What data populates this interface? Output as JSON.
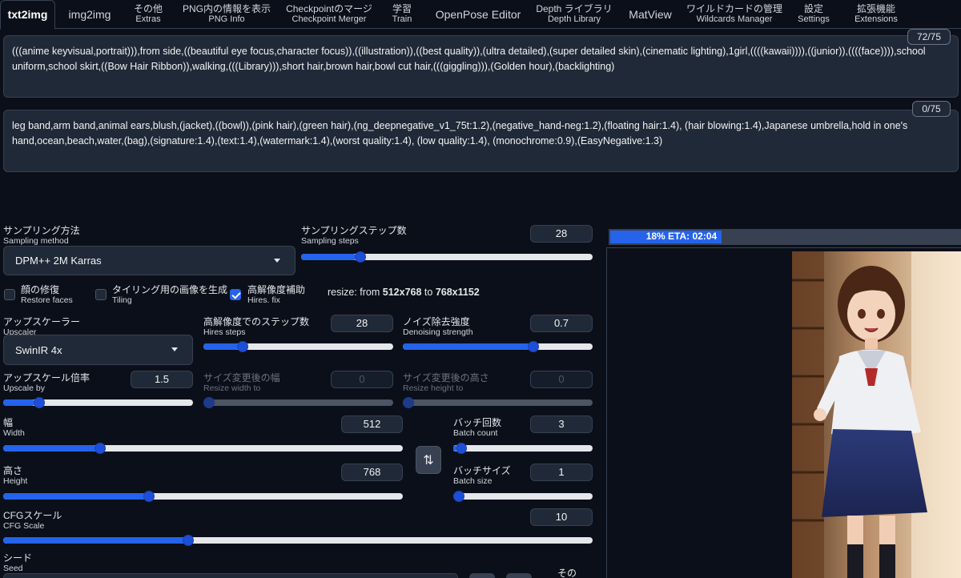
{
  "tabs": [
    {
      "label": "txt2img",
      "sub": ""
    },
    {
      "label": "img2img",
      "sub": ""
    },
    {
      "label": "その他",
      "sub": "Extras"
    },
    {
      "label": "PNG内の情報を表示",
      "sub": "PNG Info"
    },
    {
      "label": "Checkpointのマージ",
      "sub": "Checkpoint Merger"
    },
    {
      "label": "学習",
      "sub": "Train"
    },
    {
      "label": "OpenPose Editor",
      "sub": ""
    },
    {
      "label": "Depth ライブラリ",
      "sub": "Depth Library"
    },
    {
      "label": "MatView",
      "sub": ""
    },
    {
      "label": "ワイルドカードの管理",
      "sub": "Wildcards Manager"
    },
    {
      "label": "設定",
      "sub": "Settings"
    },
    {
      "label": "拡張機能",
      "sub": "Extensions"
    }
  ],
  "prompt": {
    "text": "(((anime keyvisual,portrait))),from side,((beautiful eye focus,character focus)),((illustration)),((best quality)),(ultra detailed),(super detailed skin),(cinematic lighting),1girl,((((kawaii)))),((junior)),((((face)))),school uniform,school skirt,((Bow Hair Ribbon)),walking,(((Library))),short hair,brown hair,bowl cut hair,(((giggling))),(Golden hour),(backlighting)",
    "counter": "72/75"
  },
  "negative_prompt": {
    "text": "leg band,arm band,animal ears,blush,(jacket),((bowl)),(pink hair),(green hair),(ng_deepnegative_v1_75t:1.2),(negative_hand-neg:1.2),(floating hair:1.4), (hair blowing:1.4),Japanese umbrella,hold in one's hand,ocean,beach,water,(bag),(signature:1.4),(text:1.4),(watermark:1.4),(worst quality:1.4), (low quality:1.4), (monochrome:0.9),(EasyNegative:1.3)",
    "counter": "0/75"
  },
  "sampling_method": {
    "label": "サンプリング方法",
    "sub": "Sampling method",
    "value": "DPM++ 2M Karras"
  },
  "sampling_steps": {
    "label": "サンプリングステップ数",
    "sub": "Sampling steps",
    "value": "28",
    "fraction": 0.19
  },
  "restore_faces": {
    "label": "顔の修復",
    "sub": "Restore faces",
    "checked": false
  },
  "tiling": {
    "label": "タイリング用の画像を生成",
    "sub": "Tiling",
    "checked": false
  },
  "hires_fix": {
    "label": "高解像度補助",
    "sub": "Hires. fix",
    "checked": true
  },
  "resize_info": {
    "prefix": "resize: from ",
    "from": "512x768",
    "mid": " to ",
    "to": "768x1152"
  },
  "upscaler": {
    "label": "アップスケーラー",
    "sub": "Upscaler",
    "value": "SwinIR 4x"
  },
  "hires_steps": {
    "label": "高解像度でのステップ数",
    "sub": "Hires steps",
    "value": "28",
    "fraction": 0.19
  },
  "denoising": {
    "label": "ノイズ除去強度",
    "sub": "Denoising strength",
    "value": "0.7",
    "fraction": 0.7
  },
  "upscale_by": {
    "label": "アップスケール倍率",
    "sub": "Upscale by",
    "value": "1.5",
    "fraction": 0.17
  },
  "resize_width": {
    "label": "サイズ変更後の幅",
    "sub": "Resize width to",
    "value": "0",
    "fraction": 0
  },
  "resize_height": {
    "label": "サイズ変更後の高さ",
    "sub": "Resize height to",
    "value": "0",
    "fraction": 0
  },
  "width": {
    "label": "幅",
    "sub": "Width",
    "value": "512",
    "fraction": 0.235
  },
  "height": {
    "label": "高さ",
    "sub": "Height",
    "value": "768",
    "fraction": 0.36
  },
  "batch_count": {
    "label": "バッチ回数",
    "sub": "Batch count",
    "value": "3",
    "fraction": 0.02
  },
  "batch_size": {
    "label": "バッチサイズ",
    "sub": "Batch size",
    "value": "1",
    "fraction": 0
  },
  "cfg_scale": {
    "label": "CFGスケール",
    "sub": "CFG Scale",
    "value": "10",
    "fraction": 0.31
  },
  "seed": {
    "label": "シード",
    "sub": "Seed"
  },
  "other_label": "その",
  "swap_icon": "swap-vertical-icon",
  "progress": {
    "text": "18% ETA: 02:04",
    "fraction": 0.18
  },
  "colors": {
    "accent": "#2563eb",
    "background": "#0b0f19",
    "panel": "#1f2937"
  }
}
